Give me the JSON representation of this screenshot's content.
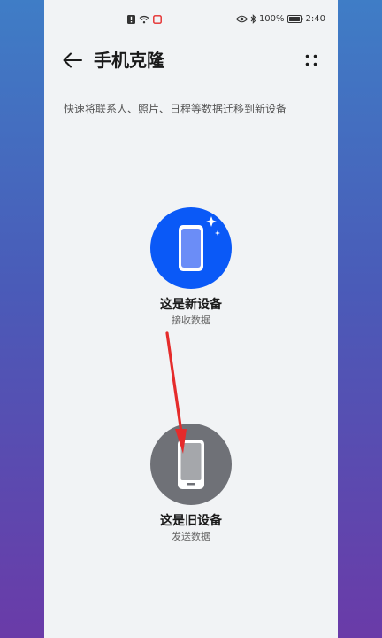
{
  "status_bar": {
    "battery_text": "100%",
    "time": "2:40"
  },
  "header": {
    "title": "手机克隆"
  },
  "subtitle": "快速将联系人、照片、日程等数据迁移到新设备",
  "options": {
    "new_device": {
      "title": "这是新设备",
      "subtitle": "接收数据"
    },
    "old_device": {
      "title": "这是旧设备",
      "subtitle": "发送数据"
    }
  },
  "colors": {
    "accent_blue": "#0a59f7",
    "old_device_gray": "#6f7177",
    "annotation_red": "#e52b2b"
  }
}
